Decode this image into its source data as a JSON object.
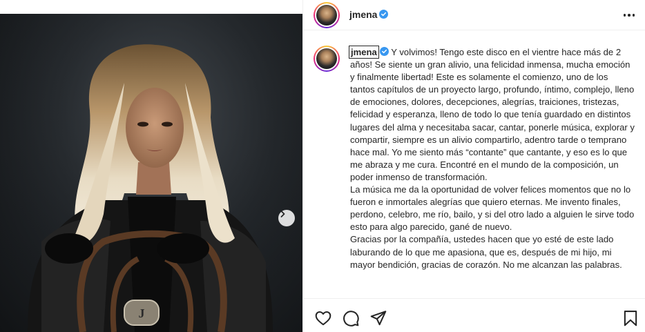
{
  "post": {
    "username": "jmena",
    "verified": true,
    "more_icon": "more-horizontal-icon"
  },
  "caption": {
    "username": "jmena",
    "paragraphs": [
      "Y volvimos! Tengo este disco en el vientre hace más de 2 años! Se siente un gran alivio, una felicidad inmensa, mucha emoción y finalmente libertad! Este es solamente el comienzo, uno de los tantos capítulos de un proyecto largo, profundo, íntimo, complejo, lleno de emociones, dolores, decepciones, alegrías, traiciones, tristezas, felicidad y esperanza, lleno de todo lo que tenía guardado en distintos lugares del alma y necesitaba sacar, cantar, ponerle música, explorar y compartir, siempre es un alivio compartirlo, adentro tarde o temprano hace mal. Yo me siento más “contante” que cantante, y eso es lo que me abraza y me cura. Encontré en el mundo de la composición, un poder inmenso de transformación.",
      "La música me da la oportunidad de volver felices momentos que no lo fueron e inmortales alegrías que quiero eternas. Me invento finales, perdono, celebro, me río, bailo, y si del otro lado a alguien le sirve todo esto para algo parecido, gané de nuevo.",
      "Gracias por la compañía, ustedes hacen que yo esté de este lado laburando de lo que me apasiona, que es, después de mi hijo, mi mayor bendición, gracias de corazón. No me alcanzan las palabras."
    ]
  },
  "actions": {
    "like_icon": "heart-icon",
    "comment_icon": "comment-icon",
    "share_icon": "share-icon",
    "save_icon": "bookmark-icon"
  },
  "media": {
    "next_icon": "chevron-right-icon"
  },
  "colors": {
    "verified": "#3897f0",
    "text": "#262626",
    "border": "#efefef"
  }
}
